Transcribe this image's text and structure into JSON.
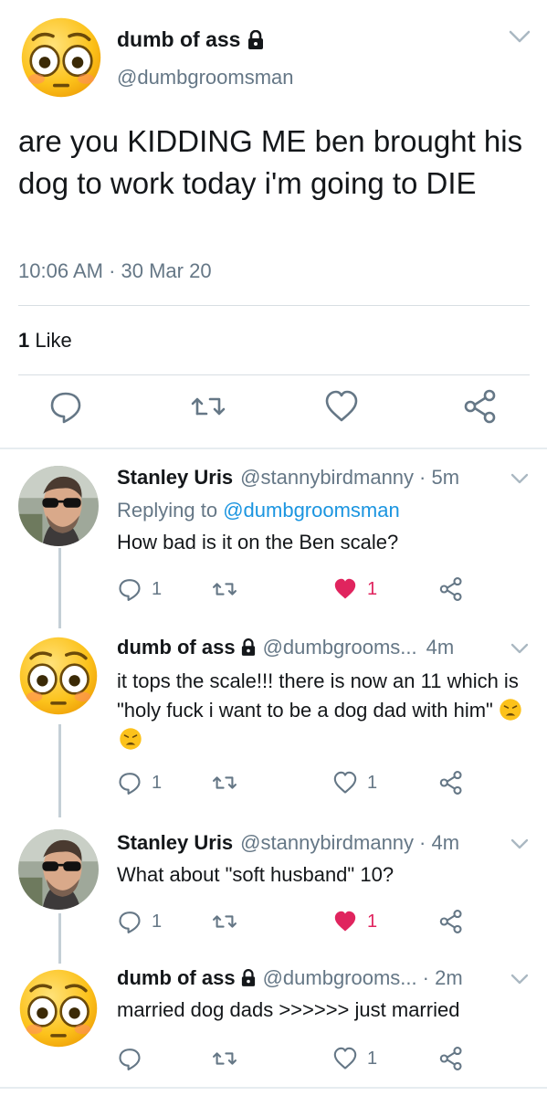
{
  "main_tweet": {
    "name": "dumb of ass",
    "handle": "@dumbgroomsman",
    "text": "are you KIDDING ME ben brought his dog to work today i'm going to DIE",
    "timestamp": "10:06 AM · 30 Mar 20",
    "like_count": "1",
    "like_label": "Like"
  },
  "replies": [
    {
      "name": "Stanley Uris",
      "handle": "@stannybirdmanny",
      "time": "· 5m",
      "replying_prefix": "Replying to",
      "replying_to": "@dumbgroomsman",
      "text": "How bad is it on the Ben scale?",
      "reply_count": "1",
      "like_count": "1",
      "liked": true
    },
    {
      "name": "dumb of ass",
      "handle": "@dumbgrooms...",
      "time": "4m",
      "text": "it tops the scale!!! there is now an 11 which is \"holy fuck i want to be a dog dad with him\"",
      "reply_count": "1",
      "like_count": "1",
      "liked": false
    },
    {
      "name": "Stanley Uris",
      "handle": "@stannybirdmanny",
      "time": "· 4m",
      "text": "What about \"soft husband\" 10?",
      "reply_count": "1",
      "like_count": "1",
      "liked": true
    },
    {
      "name": "dumb of ass",
      "handle": "@dumbgrooms...",
      "time": "· 2m",
      "text": "married dog dads >>>>>> just married",
      "reply_count": "",
      "like_count": "1",
      "liked": false
    }
  ],
  "colors": {
    "accent": "#1b95e0",
    "like_red": "#e0245e",
    "muted": "#657786"
  }
}
